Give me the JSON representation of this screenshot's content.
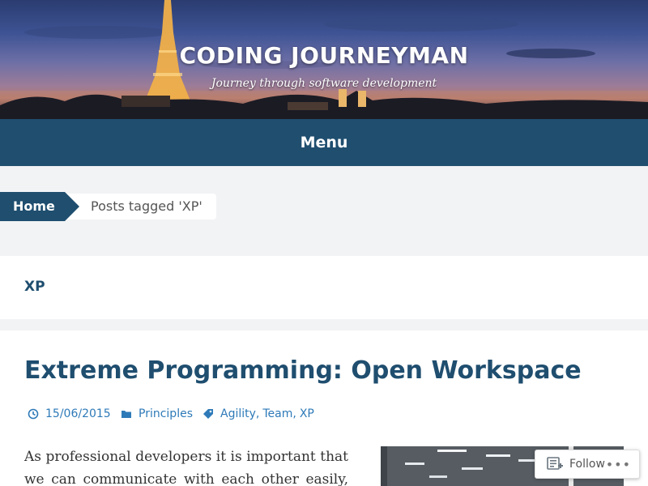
{
  "site": {
    "title": "CODING JOURNEYMAN",
    "tagline": "Journey through software development"
  },
  "menu": {
    "label": "Menu"
  },
  "breadcrumb": {
    "home": "Home",
    "current": "Posts tagged 'XP'"
  },
  "archive": {
    "title": "XP"
  },
  "post": {
    "title": "Extreme Programming: Open Workspace",
    "date": "15/06/2015",
    "category": "Principles",
    "tags": [
      "Agility",
      "Team",
      "XP"
    ],
    "excerpt_line1": "As professional developers it is important that",
    "excerpt_line2": "we can communicate with each other easily,"
  },
  "follow": {
    "label": "Follow",
    "more": "•••"
  },
  "colors": {
    "brand": "#1f4e6f",
    "link": "#2e7ab8"
  },
  "icons": [
    "clock-icon",
    "folder-icon",
    "tag-icon",
    "follow-icon",
    "more-icon"
  ]
}
